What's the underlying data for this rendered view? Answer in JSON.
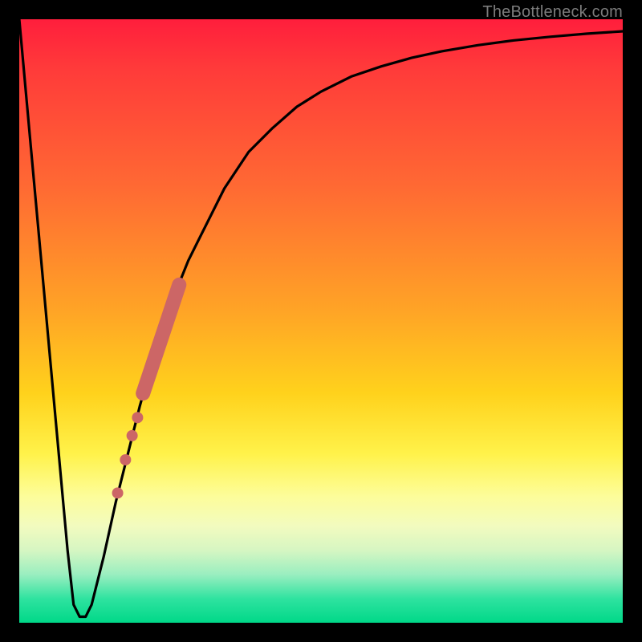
{
  "watermark": "TheBottleneck.com",
  "chart_data": {
    "type": "line",
    "title": "",
    "xlabel": "",
    "ylabel": "",
    "xlim": [
      0,
      100
    ],
    "ylim": [
      0,
      100
    ],
    "grid": false,
    "legend": false,
    "series": [
      {
        "name": "bottleneck-curve",
        "color": "#000000",
        "x": [
          0,
          2,
          4,
          6,
          8,
          9,
          10,
          11,
          12,
          14,
          16,
          18,
          20,
          22,
          24,
          26,
          28,
          30,
          34,
          38,
          42,
          46,
          50,
          55,
          60,
          65,
          70,
          76,
          82,
          88,
          94,
          100
        ],
        "y": [
          100,
          78,
          56,
          34,
          12,
          3,
          1,
          1,
          3,
          11,
          20,
          28,
          36,
          43,
          49,
          55,
          60,
          64,
          72,
          78,
          82,
          85.5,
          88,
          90.5,
          92.2,
          93.6,
          94.7,
          95.7,
          96.5,
          97.1,
          97.6,
          98
        ]
      },
      {
        "name": "highlight-band",
        "color": "#cc6666",
        "style": "thick-segment",
        "x_start": 20.5,
        "y_start": 38,
        "x_end": 26.5,
        "y_end": 56
      },
      {
        "name": "highlight-dots",
        "color": "#cc6666",
        "style": "points",
        "points": [
          {
            "x": 19.6,
            "y": 34
          },
          {
            "x": 18.7,
            "y": 31
          },
          {
            "x": 17.6,
            "y": 27
          },
          {
            "x": 16.3,
            "y": 21.5
          }
        ]
      }
    ],
    "background_gradient": {
      "direction": "vertical",
      "stops": [
        {
          "pos": 0.0,
          "color": "#ff1e3c"
        },
        {
          "pos": 0.28,
          "color": "#ff6a33"
        },
        {
          "pos": 0.62,
          "color": "#ffd21c"
        },
        {
          "pos": 0.84,
          "color": "#f2fbbf"
        },
        {
          "pos": 1.0,
          "color": "#00d888"
        }
      ]
    }
  }
}
